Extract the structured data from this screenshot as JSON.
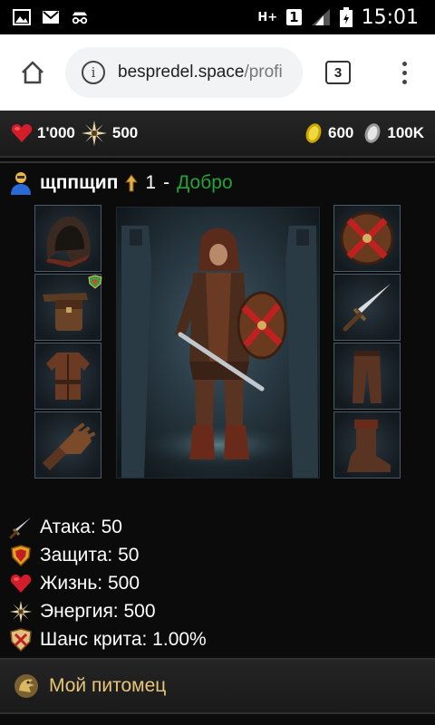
{
  "status_bar": {
    "time": "15:01",
    "network": "H+",
    "sim": "1"
  },
  "browser": {
    "url_domain": "bespredel.space",
    "url_path": "/profi",
    "tab_count": "3"
  },
  "resources": {
    "health": "1'000",
    "energy": "500",
    "gold": "600",
    "silver": "100K"
  },
  "hero": {
    "name": "щппщип",
    "level": "1",
    "separator": "-",
    "alignment": "Добро"
  },
  "stats": [
    {
      "icon": "sword-icon",
      "label": "Атака: 50"
    },
    {
      "icon": "shield-icon",
      "label": "Защита: 50"
    },
    {
      "icon": "heart-icon",
      "label": "Жизнь: 500"
    },
    {
      "icon": "energy-icon",
      "label": "Энергия: 500"
    },
    {
      "icon": "crit-shield-icon",
      "label": "Шанс крита: 1.00%"
    }
  ],
  "pet": {
    "label": "Мой питомец"
  },
  "colors": {
    "alignment_good": "#22a33a",
    "pet_text": "#e8c679",
    "accent_red": "#c02020",
    "gold": "#d8c020"
  }
}
